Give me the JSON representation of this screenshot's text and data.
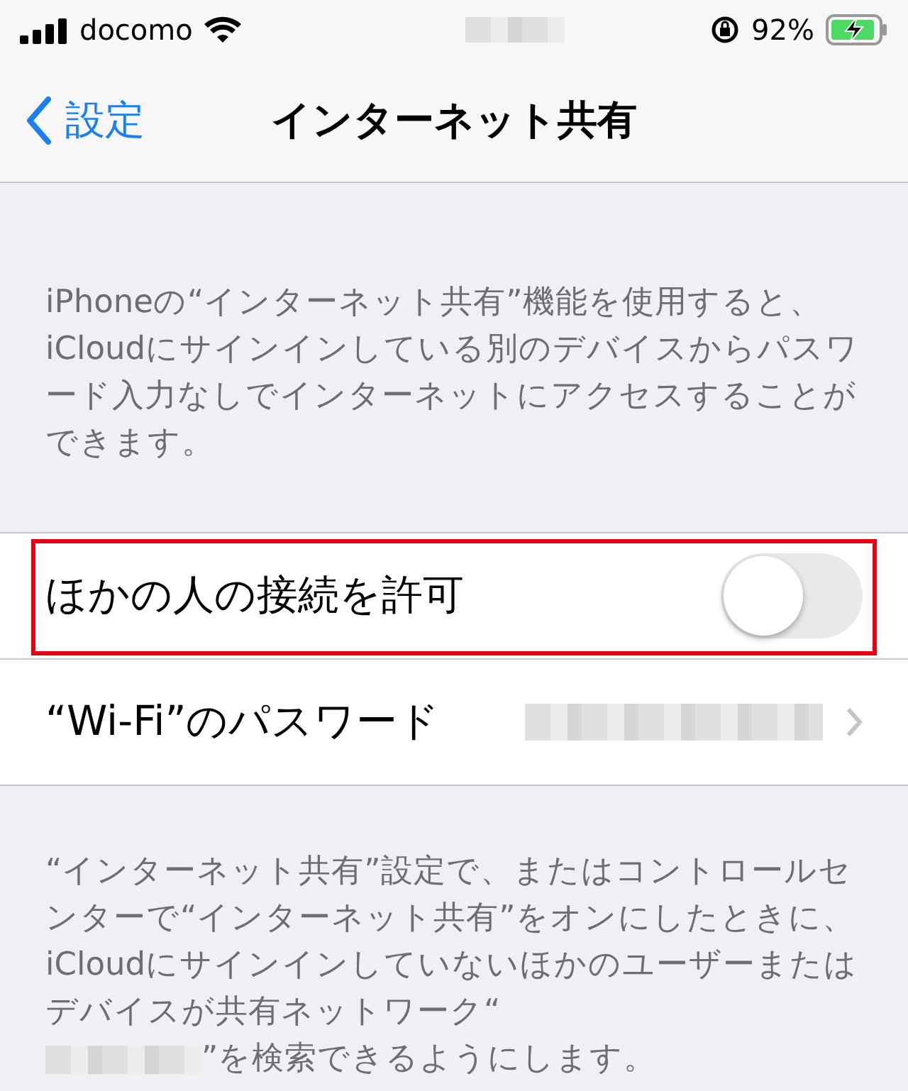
{
  "status_bar": {
    "carrier": "docomo",
    "battery_text": "92%",
    "charging": true
  },
  "nav": {
    "back": "設定",
    "title": "インターネット共有"
  },
  "header_note": "iPhoneの“インターネット共有”機能を使用すると、iCloudにサインインしている別のデバイスからパスワード入力なしでインターネットにアクセスすることができます。",
  "rows": [
    {
      "kind": "toggle",
      "label": "ほかの人の接続を許可",
      "on": false,
      "highlighted": true
    },
    {
      "kind": "link",
      "label": "“Wi-Fi”のパスワード",
      "highlighted": false
    }
  ],
  "footer_note": {
    "before": "“インターネット共有”設定で、またはコントロールセンターで“インターネット共有”をオンにしたときに、iCloudにサインインしていないほかのユーザーまたはデバイスが共有ネットワーク“",
    "after": "”を検索できるようにします。"
  }
}
